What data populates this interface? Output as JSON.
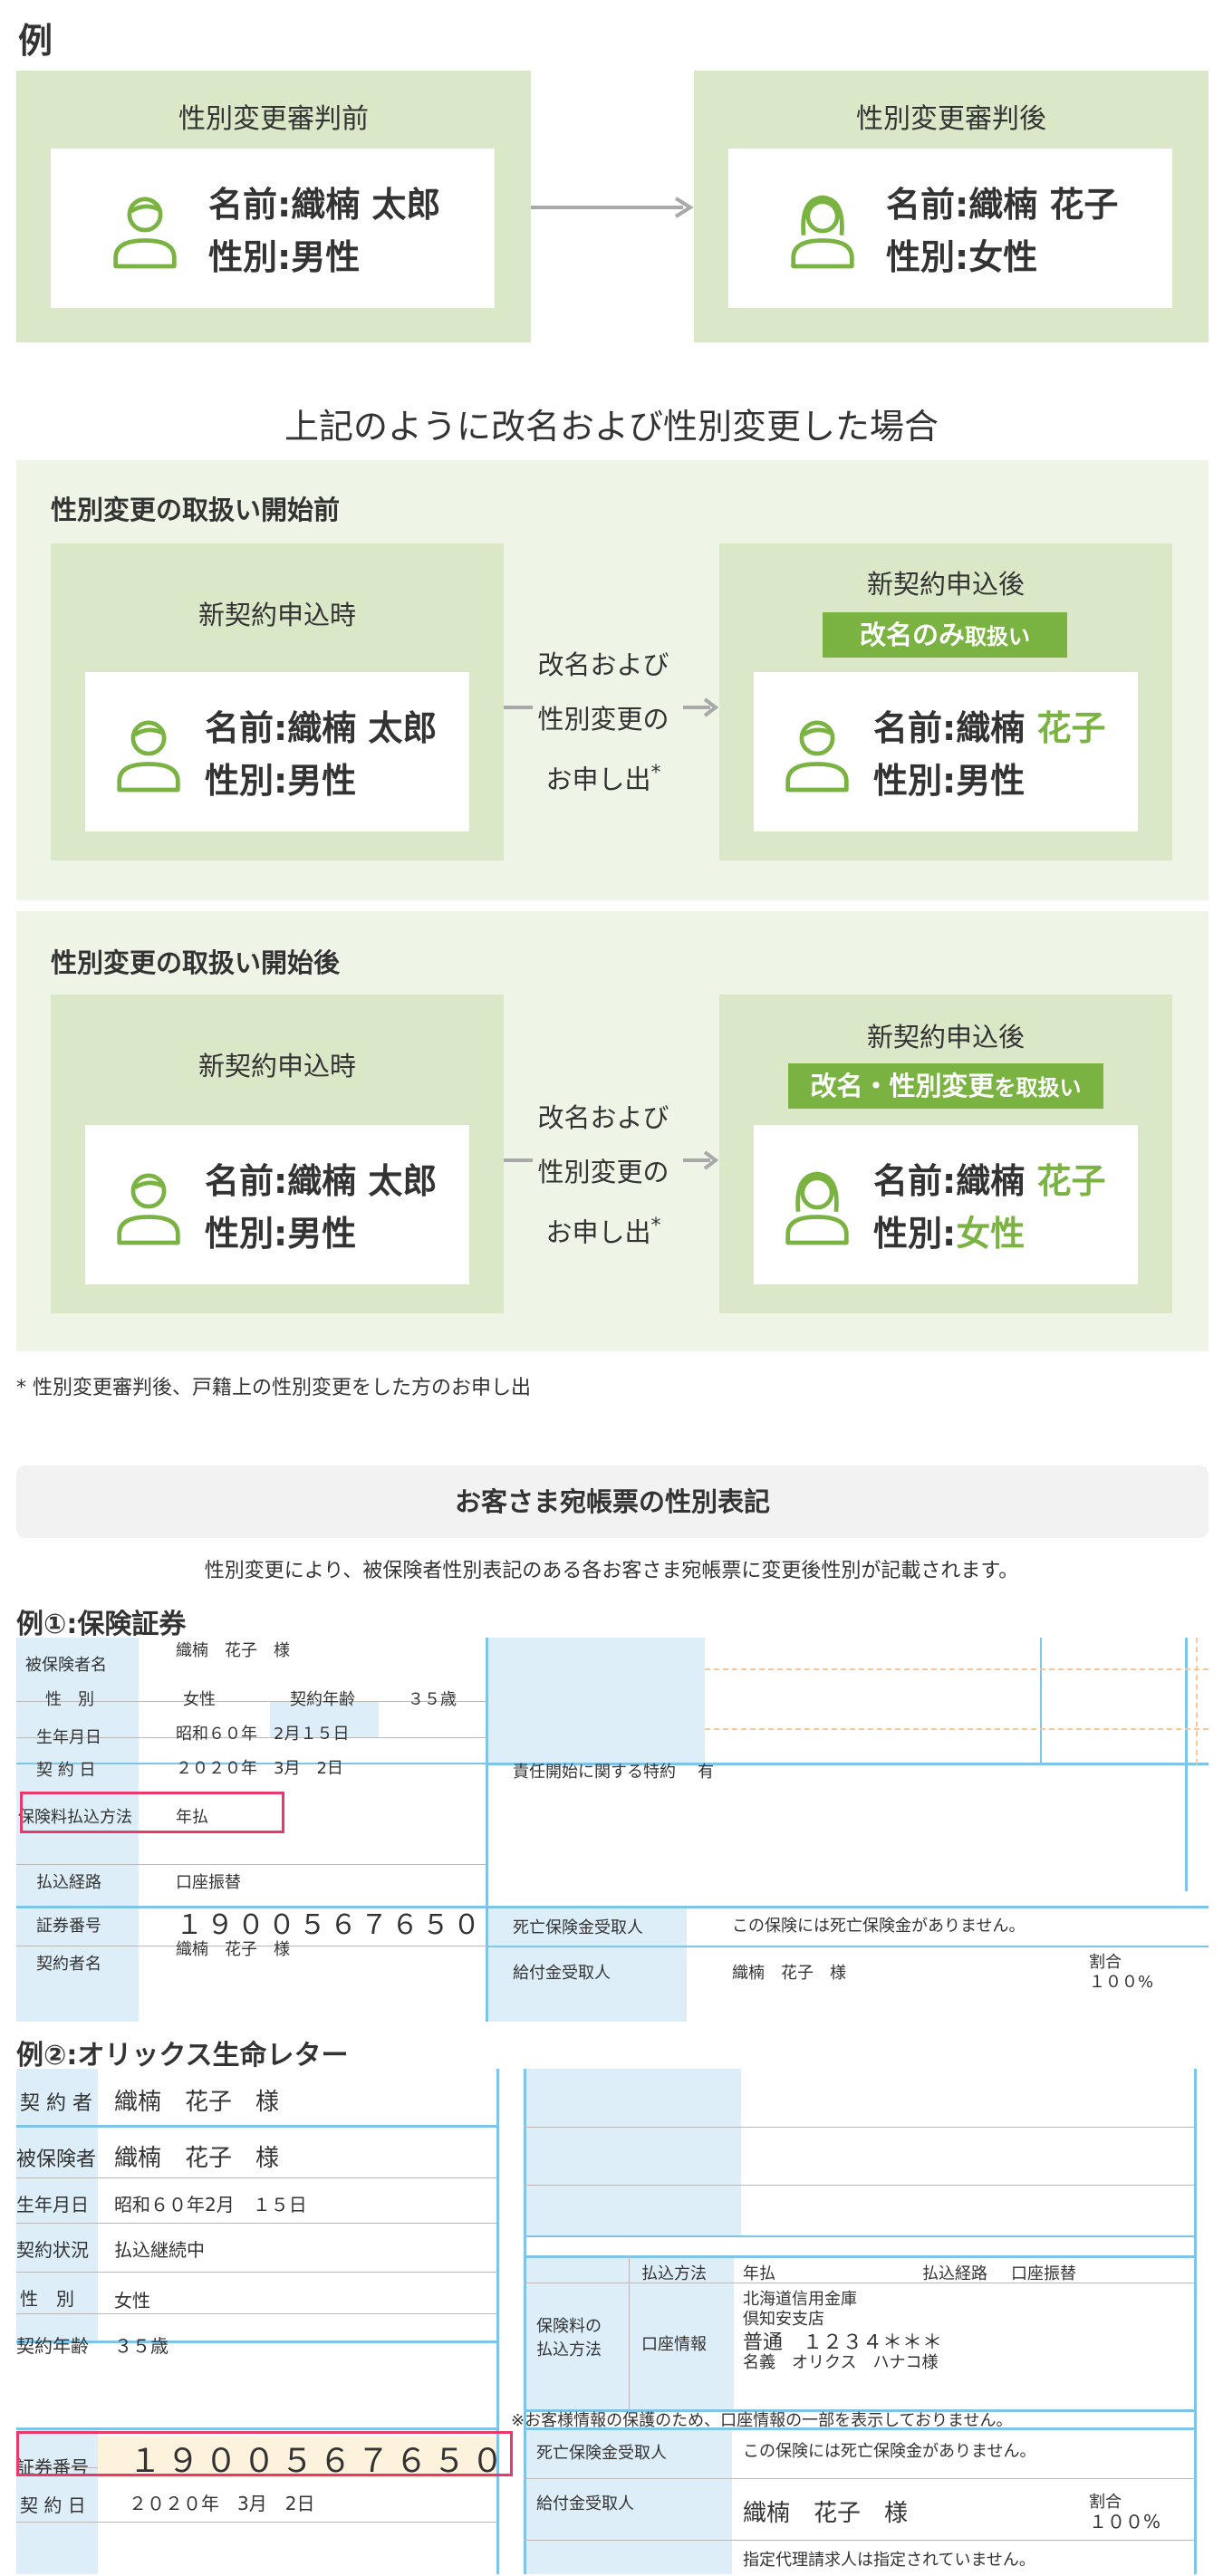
{
  "example_heading": "例",
  "top": {
    "before_title": "性別変更審判前",
    "after_title": "性別変更審判後",
    "before_name": "名前:織楠 太郎",
    "before_gender": "性別:男性",
    "after_name": "名前:織楠 花子",
    "after_gender": "性別:女性"
  },
  "case_heading": "上記のように改名および性別変更した場合",
  "sec1": {
    "title": "性別変更の取扱い開始前",
    "left_title": "新契約申込時",
    "left_name": "名前:織楠 太郎",
    "left_gender": "性別:男性",
    "arrow_l1": "改名および",
    "arrow_l2": "性別変更の",
    "arrow_l3": "お申し出",
    "arrow_mark": "*",
    "right_title": "新契約申込後",
    "badge_main": "改名のみ",
    "badge_small": "取扱い",
    "right_name_prefix": "名前:織楠 ",
    "right_name_green": "花子",
    "right_gender": "性別:男性"
  },
  "sec2": {
    "title": "性別変更の取扱い開始後",
    "left_title": "新契約申込時",
    "left_name": "名前:織楠 太郎",
    "left_gender": "性別:男性",
    "arrow_l1": "改名および",
    "arrow_l2": "性別変更の",
    "arrow_l3": "お申し出",
    "arrow_mark": "*",
    "right_title": "新契約申込後",
    "badge_main": "改名・性別変更",
    "badge_small": "を取扱い",
    "right_name_prefix": "名前:織楠 ",
    "right_name_green": "花子",
    "right_gender_prefix": "性別:",
    "right_gender_green": "女性"
  },
  "footnote": "* 性別変更審判後、戸籍上の性別変更をした方のお申し出",
  "ledger": {
    "title": "お客さま宛帳票の性別表記",
    "desc": "性別変更により、被保険者性別表記のある各お客さま宛帳票に変更後性別が記載されます。"
  },
  "ex1": {
    "heading": "例①:保険証券",
    "insured_label": "被保険者名",
    "insured_value": "織楠　花子　様",
    "gender_label": "性　別",
    "gender_value": "女性",
    "age_label": "契約年齢",
    "age_value": "３５歳",
    "birth_label": "生年月日",
    "birth_value": "昭和６０年　2月１５日",
    "contract_label": "契 約 日",
    "contract_value": "２０２０年　3月　2日",
    "special_label": "責任開始に関する特約",
    "special_value": "有",
    "payment_method_label": "保険料払込方法",
    "payment_method_value": "年払",
    "route_label": "払込経路",
    "route_value": "口座振替",
    "cert_label": "証券番号",
    "cert_value": "１９００５６７６５０",
    "death_label": "死亡保険金受取人",
    "death_value": "この保険には死亡保険金がありません。",
    "holder_label": "契約者名",
    "holder_value": "織楠　花子　様",
    "benefit_label": "給付金受取人",
    "benefit_value": "織楠　花子　様",
    "ratio_label": "割合",
    "ratio_value": "１００%"
  },
  "ex2": {
    "heading": "例②:オリックス生命レター",
    "holder_label": "契 約 者",
    "holder_value": "織楠　花子　様",
    "insured_label": "被保険者",
    "insured_value": "織楠　花子　様",
    "birth_label": "生年月日",
    "birth_value": "昭和６０年2月　１５日",
    "status_label": "契約状況",
    "status_value": "払込継続中",
    "gender_label": "性　別",
    "gender_value": "女性",
    "age_label": "契約年齢",
    "age_value": "３５歳",
    "pay_label1": "保険料の",
    "pay_label2": "払込方法",
    "method_label": "払込方法",
    "method_value": "年払",
    "route_label": "払込経路",
    "route_value": "口座振替",
    "account_label": "口座情報",
    "bank1": "北海道信用金庫",
    "bank2": "倶知安支店",
    "bank3": "普通　１２３４＊＊＊",
    "bank4": "名義　オリクス　ハナコ様",
    "notice": "※お客様情報の保護のため、口座情報の一部を表示しておりません。",
    "cert_label": "証券番号",
    "cert_value": "１９００５６７６５０",
    "contract_label": "契 約 日",
    "contract_value": "２０２０年　3月　2日",
    "death_label": "死亡保険金受取人",
    "death_value": "この保険には死亡保険金がありません。",
    "benefit_label": "給付金受取人",
    "benefit_value": "織楠　花子　様",
    "ratio_label": "割合",
    "ratio_value": "１００%",
    "agent_value": "指定代理請求人は指定されていません。"
  },
  "colors": {
    "green": "#7ab342",
    "panel": "#dae8c8",
    "panel_light": "#eef5e6",
    "highlight": "#e8396a",
    "blue_line": "#7ec3e8"
  }
}
